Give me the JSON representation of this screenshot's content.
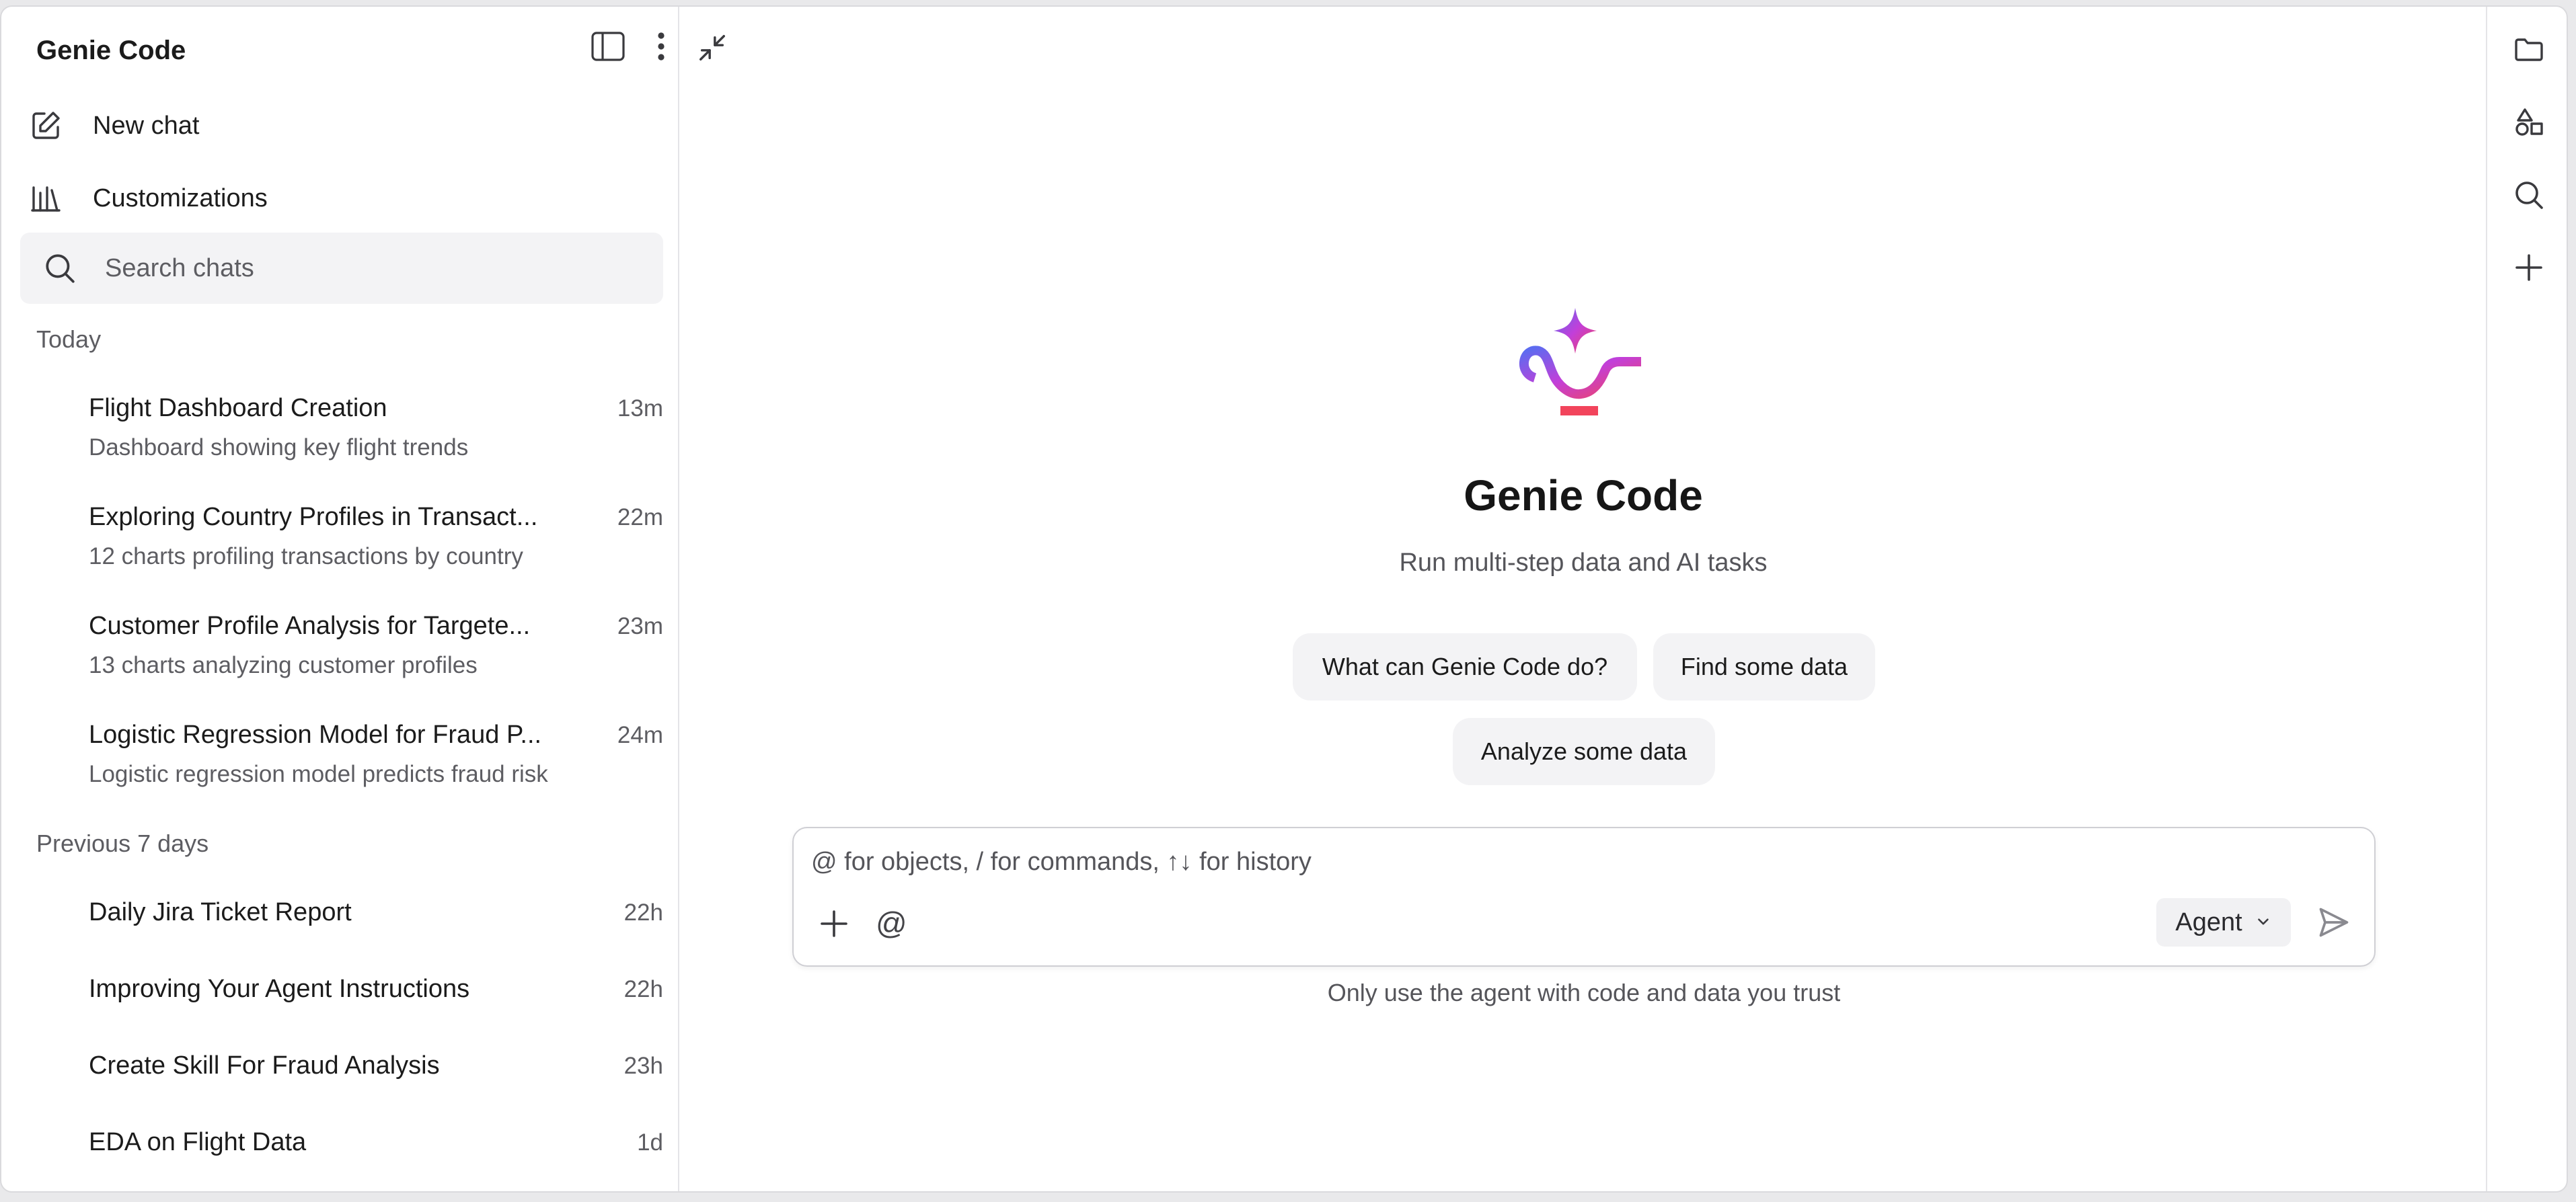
{
  "sidebar": {
    "title": "Genie Code",
    "icons": {
      "toggle": "sidebar-panel-icon",
      "more": "more-vertical-icon"
    },
    "new_chat_label": "New chat",
    "customizations_label": "Customizations",
    "search_placeholder": "Search chats",
    "sections": [
      {
        "label": "Today",
        "items": [
          {
            "title": "Flight Dashboard Creation",
            "subtitle": "Dashboard showing key flight trends",
            "time": "13m"
          },
          {
            "title": "Exploring Country Profiles in Transact...",
            "subtitle": "12 charts profiling transactions by country",
            "time": "22m"
          },
          {
            "title": "Customer Profile Analysis for Targete...",
            "subtitle": "13 charts analyzing customer profiles",
            "time": "23m"
          },
          {
            "title": "Logistic Regression Model for Fraud P...",
            "subtitle": "Logistic regression model predicts fraud risk",
            "time": "24m"
          }
        ]
      },
      {
        "label": "Previous 7 days",
        "items": [
          {
            "title": "Daily Jira Ticket Report",
            "time": "22h"
          },
          {
            "title": "Improving Your Agent Instructions",
            "time": "22h"
          },
          {
            "title": "Create Skill For Fraud Analysis",
            "time": "23h"
          },
          {
            "title": "EDA on Flight Data",
            "time": "1d"
          }
        ]
      }
    ]
  },
  "main": {
    "title": "Genie Code",
    "subtitle": "Run multi-step data and AI tasks",
    "suggestions": [
      "What can Genie Code do?",
      "Find some data",
      "Analyze some data"
    ],
    "composer": {
      "placeholder": "@ for objects, / for commands, ↑↓ for history",
      "at_label": "@",
      "mode_label": "Agent"
    },
    "disclaimer": "Only use the agent with code and data you trust"
  },
  "rail": {
    "icons": [
      "folder-icon",
      "shapes-icon",
      "search-icon",
      "plus-icon"
    ]
  },
  "colors": {
    "logo_gradient_start": "#5b6cf0",
    "logo_gradient_mid": "#c23fd9",
    "logo_gradient_end": "#f2445c"
  }
}
